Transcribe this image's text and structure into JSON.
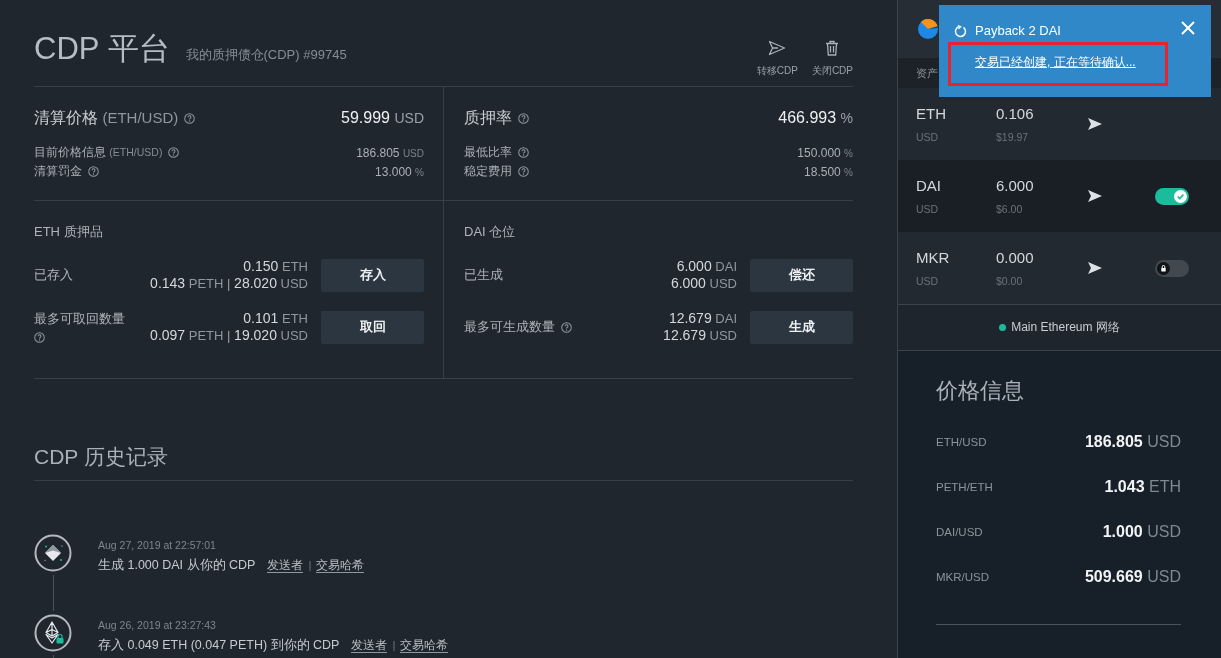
{
  "header": {
    "title": "CDP 平台",
    "subtitle": "我的质押债仓(CDP) #99745",
    "actions": [
      {
        "kind": "send",
        "label": "转移CDP"
      },
      {
        "kind": "trash",
        "label": "关闭CDP"
      }
    ]
  },
  "summary": [
    {
      "title": "清算价格",
      "note": "(ETH/USD)",
      "help": true,
      "value": "59.999",
      "unit": "USD",
      "details": [
        {
          "label": "目前价格信息",
          "note": "(ETH/USD)",
          "help": true,
          "value": "186.805",
          "unit": "USD"
        },
        {
          "label": "清算罚金",
          "help": true,
          "value": "13.000",
          "unit": "%"
        }
      ]
    },
    {
      "title": "质押率",
      "help": true,
      "value": "466.993",
      "unit": "%",
      "details": [
        {
          "label": "最低比率",
          "help": true,
          "value": "150.000",
          "unit": "%"
        },
        {
          "label": "稳定费用",
          "help": true,
          "value": "18.500",
          "unit": "%"
        }
      ]
    }
  ],
  "positions": [
    {
      "title": "ETH 质押品",
      "rows": [
        {
          "label": "已存入",
          "help": false,
          "lines": [
            [
              {
                "value": "0.150",
                "unit": "ETH"
              }
            ],
            [
              {
                "value": "0.143",
                "unit": "PETH"
              },
              {
                "sep": "|"
              },
              {
                "value": "28.020",
                "unit": "USD"
              }
            ]
          ],
          "button": "存入"
        },
        {
          "label": "最多可取回数量",
          "help": true,
          "lines": [
            [
              {
                "value": "0.101",
                "unit": "ETH"
              }
            ],
            [
              {
                "value": "0.097",
                "unit": "PETH"
              },
              {
                "sep": "|"
              },
              {
                "value": "19.020",
                "unit": "USD"
              }
            ]
          ],
          "button": "取回"
        }
      ]
    },
    {
      "title": "DAI 仓位",
      "rows": [
        {
          "label": "已生成",
          "help": false,
          "lines": [
            [
              {
                "value": "6.000",
                "unit": "DAI"
              }
            ],
            [
              {
                "value": "6.000",
                "unit": "USD"
              }
            ]
          ],
          "button": "偿还"
        },
        {
          "label": "最多可生成数量",
          "help": true,
          "lines": [
            [
              {
                "value": "12.679",
                "unit": "DAI"
              }
            ],
            [
              {
                "value": "12.679",
                "unit": "USD"
              }
            ]
          ],
          "button": "生成"
        }
      ]
    }
  ],
  "history": {
    "title": "CDP 历史记录",
    "items": [
      {
        "kind": "generate",
        "date": "Aug 27, 2019 at 22:57:01",
        "text": "生成 1.000 DAI 从你的 CDP",
        "links": [
          "发送者",
          "交易哈希"
        ],
        "separator": "|"
      },
      {
        "kind": "deposit",
        "date": "Aug 26, 2019 at 23:27:43",
        "text": "存入 0.049 ETH (0.047 PETH) 到你的 CDP",
        "links": [
          "发送者",
          "交易哈希"
        ],
        "separator": "|"
      }
    ]
  },
  "wallet": {
    "columns": [
      "资产"
    ],
    "tokens": [
      {
        "kind": "plain",
        "symbol": "ETH",
        "currency": "USD",
        "amount": "0.106",
        "usd": "$19.97"
      },
      {
        "kind": "toggle",
        "symbol": "DAI",
        "currency": "USD",
        "amount": "6.000",
        "usd": "$6.00",
        "unlocked": true
      },
      {
        "kind": "toggle",
        "symbol": "MKR",
        "currency": "USD",
        "amount": "0.000",
        "usd": "$0.00",
        "unlocked": false
      }
    ],
    "network": {
      "name": "Main Ethereum 网络",
      "color": "#1abc9c"
    }
  },
  "prices": {
    "title": "价格信息",
    "rows": [
      {
        "pair": "ETH/USD",
        "value": "186.805",
        "unit": "USD"
      },
      {
        "pair": "PETH/ETH",
        "value": "1.043",
        "unit": "ETH"
      },
      {
        "pair": "DAI/USD",
        "value": "1.000",
        "unit": "USD"
      },
      {
        "pair": "MKR/USD",
        "value": "509.669",
        "unit": "USD"
      }
    ]
  },
  "notification": {
    "title": "Payback 2 DAI",
    "message": "交易已经创建, 正在等待确认...",
    "highlighted": true
  }
}
